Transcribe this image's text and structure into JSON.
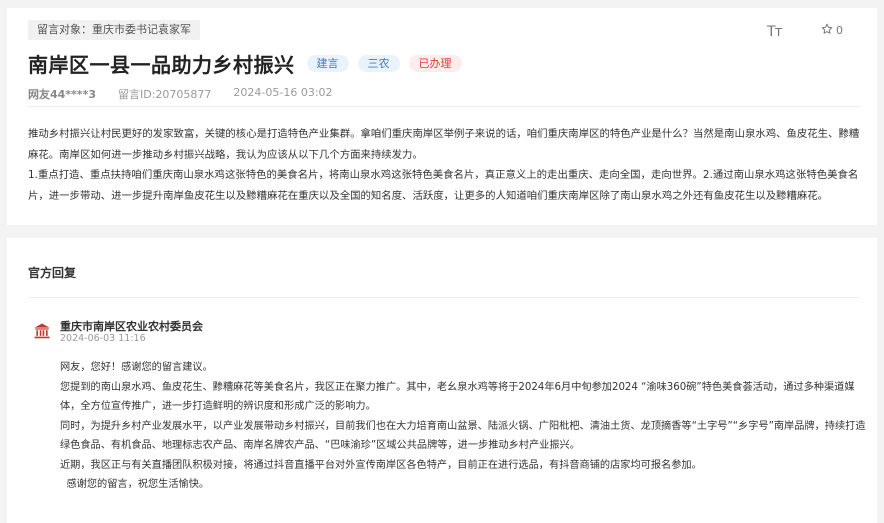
{
  "message": {
    "target": "留言对象：重庆市委书记袁家军",
    "title": "南岸区一县一品助力乡村振兴",
    "tags": [
      {
        "label": "建言",
        "color": "#3d7cc9"
      },
      {
        "label": "三农",
        "color": "#3d7cc9"
      },
      {
        "label": "已办理",
        "color": "#d9403a"
      }
    ],
    "author": "网友44****3",
    "message_id": "留言ID:20705877",
    "date": "2024-05-16 03:02",
    "font_toggle_label": "Tт",
    "favorite_count": "0",
    "paragraphs": [
      "推动乡村振兴让村民更好的发家致富，关键的核心是打造特色产业集群。拿咱们重庆南岸区举例子来说的话，咱们重庆南岸区的特色产业是什么？当然是南山泉水鸡、鱼皮花生、黪糟麻花。南岸区如何进一步推动乡村振兴战略，我认为应该从以下几个方面来持续发力。",
      "1.重点打造、重点扶持咱们重庆南山泉水鸡这张特色的美食名片，将南山泉水鸡这张特色美食名片，真正意义上的走出重庆、走向全国，走向世界。2.通过南山泉水鸡这张特色美食名片，进一步带动、进一步提升南岸鱼皮花生以及黪糟麻花在重庆以及全国的知名度、活跃度，让更多的人知道咱们重庆南岸区除了南山泉水鸡之外还有鱼皮花生以及黪糟麻花。"
    ]
  },
  "reply": {
    "section_title": "官方回复",
    "org_name": "重庆市南岸区农业农村委员会",
    "org_icon": "government-building-icon",
    "time": "2024-06-03 11:16",
    "paragraphs": [
      "网友，您好！感谢您的留言建议。",
      "您提到的南山泉水鸡、鱼皮花生、黪糟麻花等美食名片，我区正在聚力推广。其中，老幺泉水鸡等将于2024年6月中旬参加2024 “渝味360碗”特色美食荟活动，通过多种渠道媒体，全方位宣传推广，进一步打造鲜明的辨识度和形成广泛的影响力。",
      "同时，为提升乡村产业发展水平，以产业发展带动乡村振兴，目前我们也在大力培育南山盆景、陆派火锅、广阳枇杷、清油土货、龙顶摘香等“土字号”“乡字号”南岸品牌，持续打造绿色食品、有机食品、地理标志农产品、南岸名牌农产品、“巴味渝珍”区域公共品牌等，进一步推动乡村产业振兴。",
      "近期，我区正与有关直播团队积极对接，将通过抖音直播平台对外宣传南岸区各色特产，目前正在进行选品，有抖音商铺的店家均可报名参加。",
      "  感谢您的留言，祝您生活愉快。"
    ]
  },
  "colors": {
    "page_bg": "#f3f3f3",
    "tag_blue": "#3d7cc9",
    "tag_red": "#d9403a",
    "org_icon": "#c0392b"
  }
}
